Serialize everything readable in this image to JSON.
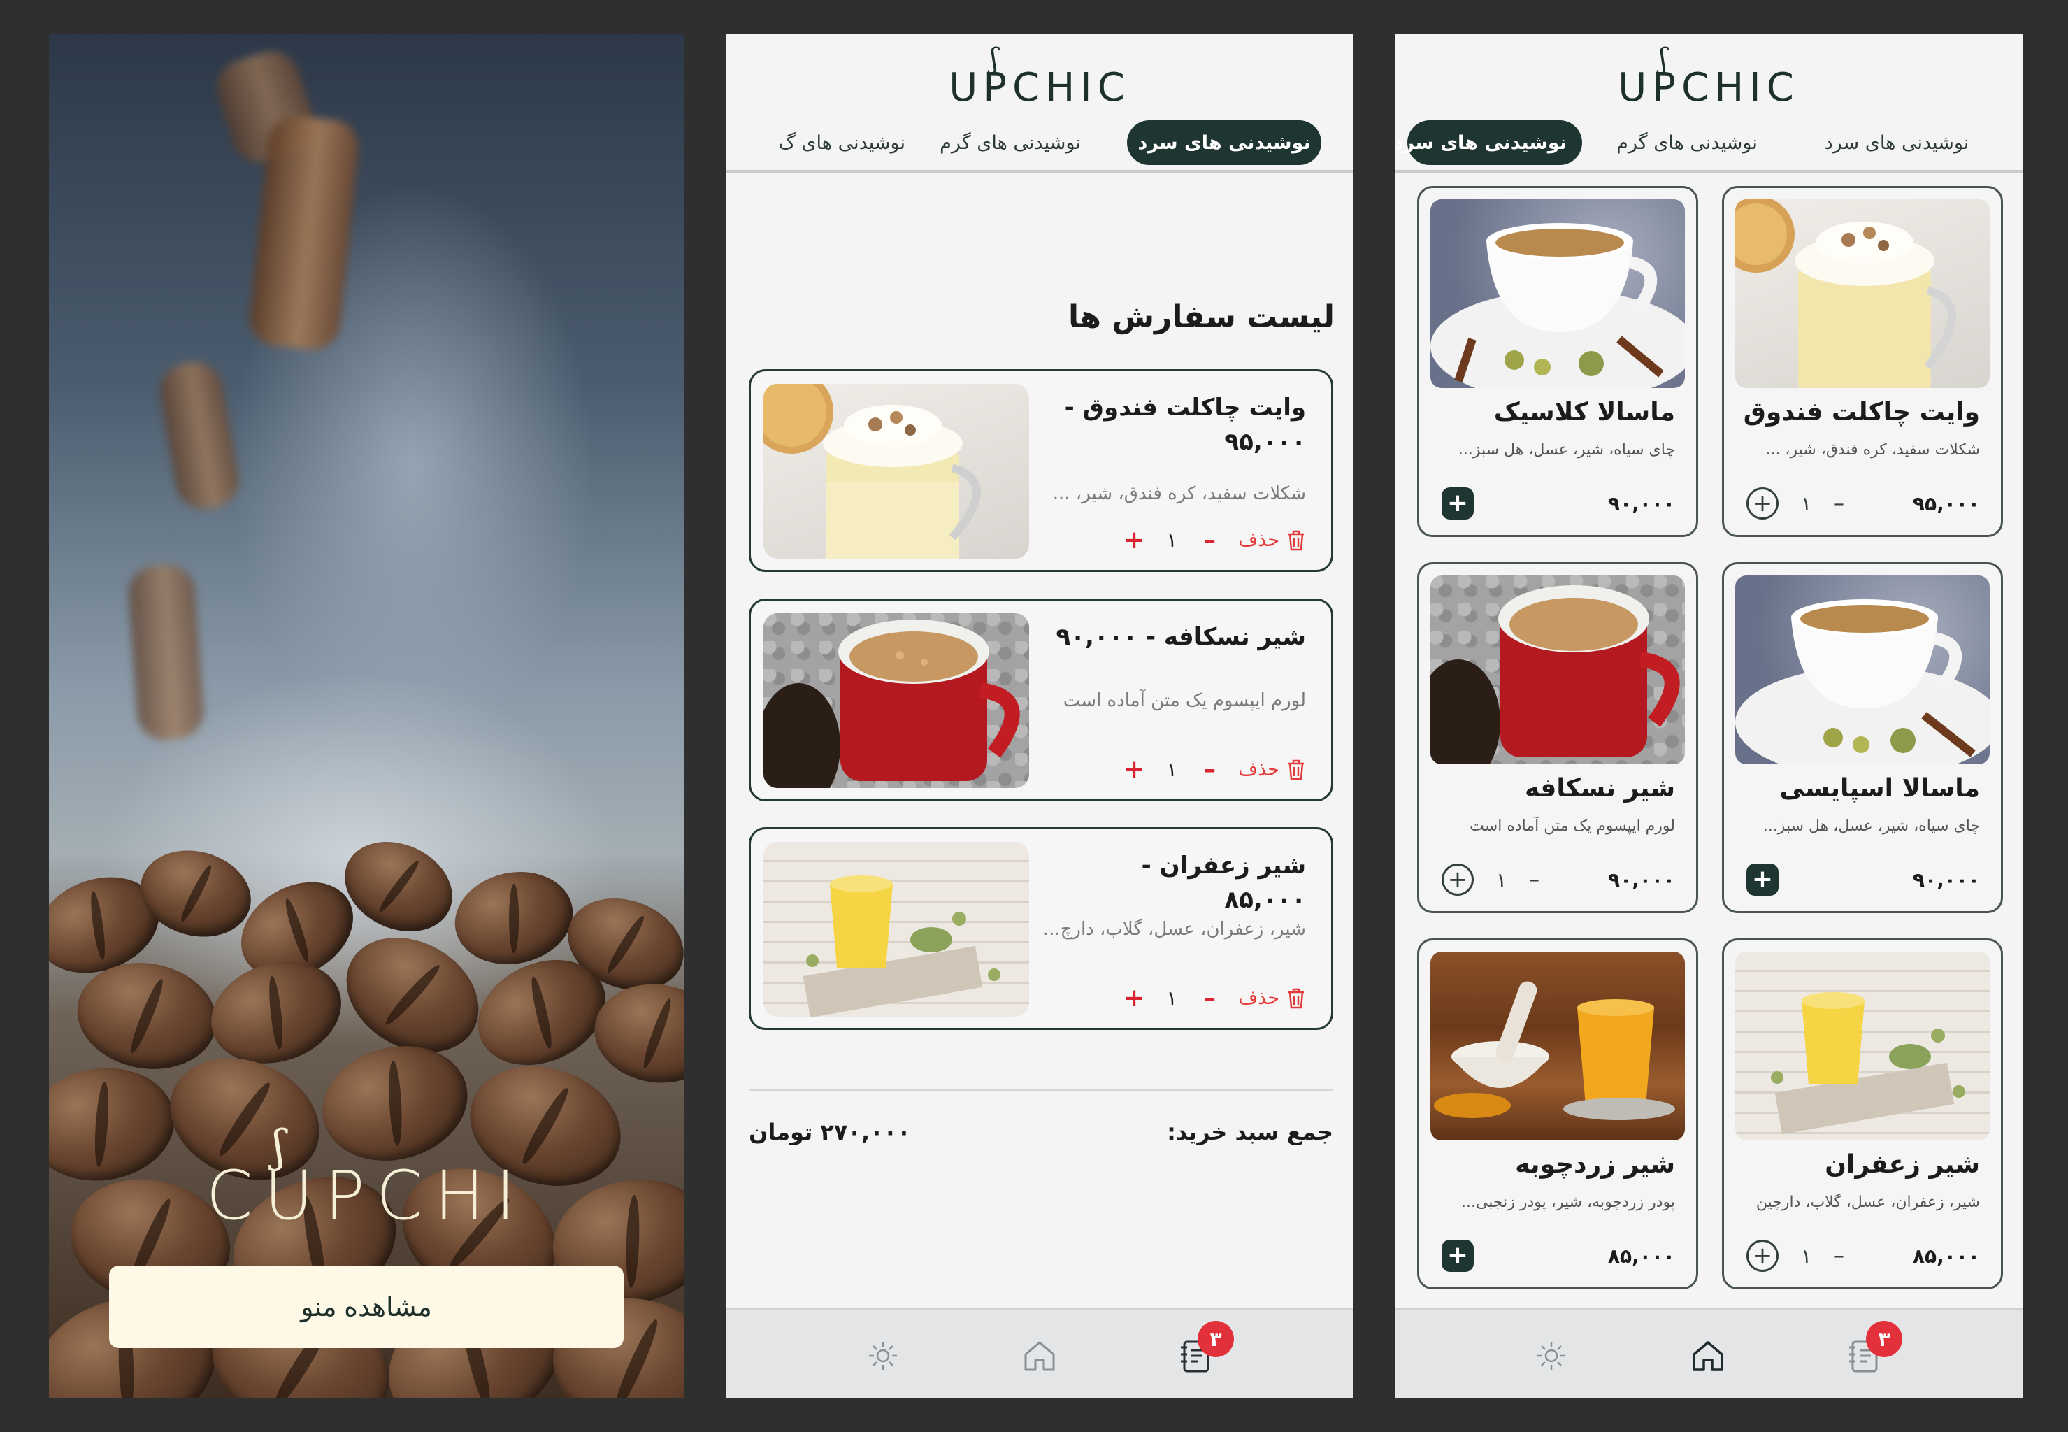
{
  "brand": {
    "name": "CUPCHI",
    "name_first": "C",
    "name_rest": "UPCHI",
    "steam": "ʃ"
  },
  "splash": {
    "cta_label": "مشاهده منو"
  },
  "tabs": {
    "cold": "نوشیدنی های سرد",
    "hot": "نوشیدنی های گرم",
    "third_partial": "نوشیدنی های گ",
    "cold_partial": "نوشیدنی های سرد"
  },
  "orders": {
    "title": "لیست سفارش ها",
    "delete_label": "حذف",
    "items": [
      {
        "name": "وایت چاکلت فندوق - ۹۵,۰۰۰",
        "desc": "شکلات سفید، کره فندق، شیر، ...",
        "qty": "۱"
      },
      {
        "name": "شیر نسکافه - ۹۰,۰۰۰",
        "desc": "لورم ایپسوم یک متن آماده است",
        "qty": "۱"
      },
      {
        "name": "شیر زعفران - ۸۵,۰۰۰",
        "desc": "شیر، زعفران، عسل، گلاب، دارچ...",
        "qty": "۱"
      }
    ],
    "total_label": "جمع سبد خرید:",
    "total_value": "۲۷۰,۰۰۰ تومان"
  },
  "nav": {
    "badge": "۳",
    "icons": [
      "sun-icon",
      "home-icon",
      "notebook-icon"
    ]
  },
  "products": [
    {
      "title": "وایت چاکلت فندوق",
      "desc": "شکلات سفید، کره فندق، شیر، ...",
      "price": "۹۵,۰۰۰",
      "qty": "۱",
      "in_cart": true
    },
    {
      "title": "ماسالا کلاسیک",
      "desc": "چای سیاه، شیر، عسل، هل سبز...",
      "price": "۹۰,۰۰۰",
      "qty": "",
      "in_cart": false
    },
    {
      "title": "ماسالا اسپایسی",
      "desc": "چای سیاه، شیر، عسل، هل سبز...",
      "price": "۹۰,۰۰۰",
      "qty": "",
      "in_cart": false
    },
    {
      "title": "شیر نسکافه",
      "desc": "لورم ایپسوم یک متن آماده است",
      "price": "۹۰,۰۰۰",
      "qty": "۱",
      "in_cart": true
    },
    {
      "title": "شیر زعفران",
      "desc": "شیر، زعفران، عسل، گلاب، دارچین",
      "price": "۸۵,۰۰۰",
      "qty": "۱",
      "in_cart": true
    },
    {
      "title": "شیر زردچوبه",
      "desc": "پودر زردچوبه، شیر، پودر زنجبی...",
      "price": "۸۵,۰۰۰",
      "qty": "",
      "in_cart": false
    }
  ],
  "colors": {
    "primary": "#1f3531",
    "danger": "#e2313a",
    "cream": "#fdf9e6",
    "surface": "#f4f4f5"
  }
}
